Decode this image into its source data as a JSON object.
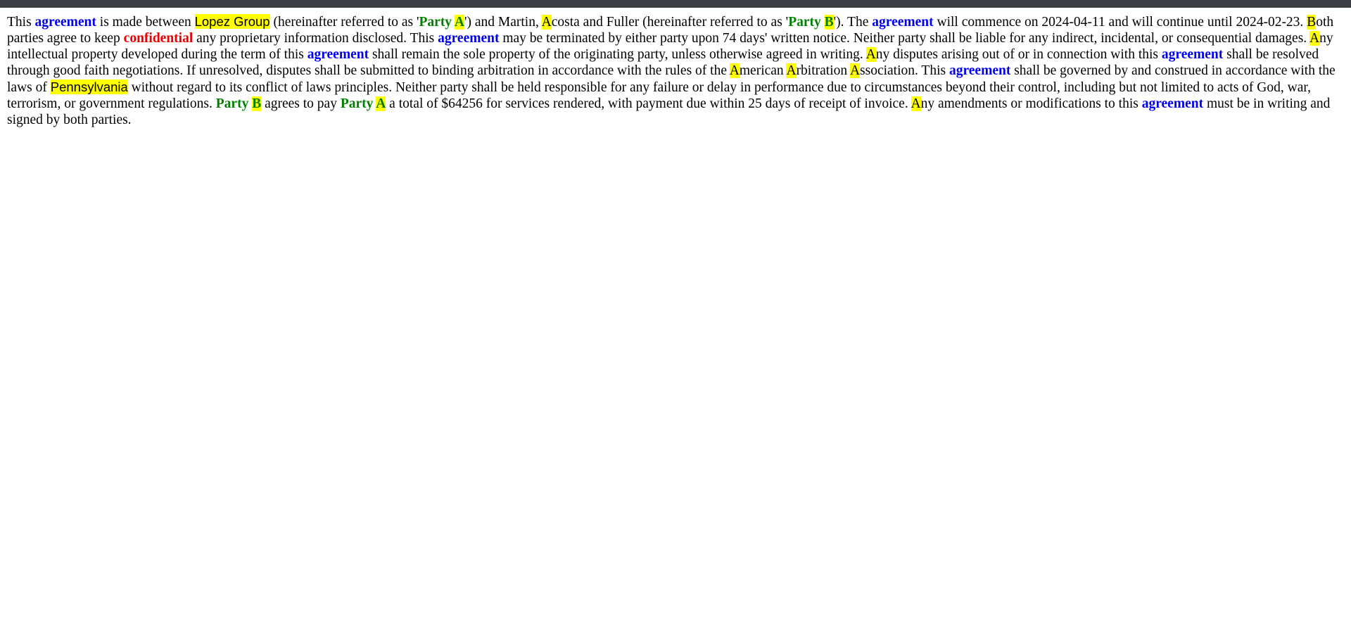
{
  "tokens": [
    {
      "t": "This ",
      "s": ""
    },
    {
      "t": "agreement",
      "s": "kw-blue"
    },
    {
      "t": " is made between ",
      "s": ""
    },
    {
      "t": "Lopez Group",
      "s": "hl-sans"
    },
    {
      "t": " (hereinafter referred to as '",
      "s": ""
    },
    {
      "t": "Party ",
      "s": "kw-green"
    },
    {
      "t": "A",
      "s": "kw-green hl"
    },
    {
      "t": "') and Martin, ",
      "s": ""
    },
    {
      "t": "A",
      "s": "hl"
    },
    {
      "t": "costa and Fuller (hereinafter referred to as '",
      "s": ""
    },
    {
      "t": "Party ",
      "s": "kw-green"
    },
    {
      "t": "B",
      "s": "kw-green hl"
    },
    {
      "t": "'). The ",
      "s": ""
    },
    {
      "t": "agreement",
      "s": "kw-blue"
    },
    {
      "t": " will commence on 2024-04-11 and will continue until 2024-02-23. ",
      "s": ""
    },
    {
      "t": "B",
      "s": "hl"
    },
    {
      "t": "oth parties agree to keep ",
      "s": ""
    },
    {
      "t": "confidential",
      "s": "kw-red"
    },
    {
      "t": " any proprietary information disclosed. This ",
      "s": ""
    },
    {
      "t": "agreement",
      "s": "kw-blue"
    },
    {
      "t": " may be terminated by either party upon 74 days' written notice. Neither party shall be liable for any indirect, incidental, or consequential damages. ",
      "s": ""
    },
    {
      "t": "A",
      "s": "hl"
    },
    {
      "t": "ny intellectual property developed during the term of this ",
      "s": ""
    },
    {
      "t": "agreement",
      "s": "kw-blue"
    },
    {
      "t": " shall remain the sole property of the originating party, unless otherwise agreed in writing. ",
      "s": ""
    },
    {
      "t": "A",
      "s": "hl"
    },
    {
      "t": "ny disputes arising out of or in connection with this ",
      "s": ""
    },
    {
      "t": "agreement",
      "s": "kw-blue"
    },
    {
      "t": " shall be resolved through good faith negotiations. If unresolved, disputes shall be submitted to binding arbitration in accordance with the rules of the ",
      "s": ""
    },
    {
      "t": "A",
      "s": "hl"
    },
    {
      "t": "merican ",
      "s": ""
    },
    {
      "t": "A",
      "s": "hl"
    },
    {
      "t": "rbitration ",
      "s": ""
    },
    {
      "t": "A",
      "s": "hl"
    },
    {
      "t": "ssociation. This ",
      "s": ""
    },
    {
      "t": "agreement",
      "s": "kw-blue"
    },
    {
      "t": " shall be governed by and construed in accordance with the laws of ",
      "s": ""
    },
    {
      "t": "Pennsylvania",
      "s": "hl-sans"
    },
    {
      "t": " without regard to its conflict of laws principles. Neither party shall be held responsible for any failure or delay in performance due to circumstances beyond their control, including but not limited to acts of God, war, terrorism, or government regulations. ",
      "s": ""
    },
    {
      "t": "Party ",
      "s": "kw-green"
    },
    {
      "t": "B",
      "s": "kw-green hl"
    },
    {
      "t": " agrees to pay ",
      "s": ""
    },
    {
      "t": "Party ",
      "s": "kw-green"
    },
    {
      "t": "A",
      "s": "kw-green hl"
    },
    {
      "t": " a total of $64256 for services rendered, with payment due within 25 days of receipt of invoice. ",
      "s": ""
    },
    {
      "t": "A",
      "s": "hl"
    },
    {
      "t": "ny amendments or modifications to this ",
      "s": ""
    },
    {
      "t": "agreement",
      "s": "kw-blue"
    },
    {
      "t": " must be in writing and signed by both parties.",
      "s": ""
    }
  ]
}
